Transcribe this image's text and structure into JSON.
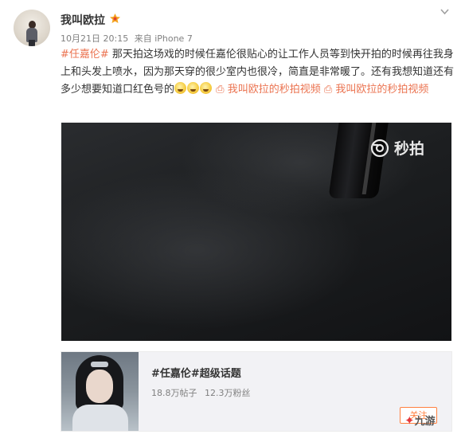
{
  "post": {
    "author": "我叫欧拉",
    "timestamp": "10月21日 20:15",
    "source": "来自 iPhone 7",
    "topic": "#任嘉伦#",
    "text_main": " 那天拍这场戏的时候任嘉伦很贴心的让工作人员等到快开拍的时候再往我身上和头发上喷水，因为那天穿的很少室内也很冷，简直是非常暖了。还有我想知道还有多少想要知道口红色号的",
    "video_link_1": "我叫欧拉的秒拍视频",
    "video_link_2": "我叫欧拉的秒拍视频",
    "more_icon": "chevron-down-icon"
  },
  "video": {
    "watermark": "秒拍",
    "watermark_icon": "camera-icon"
  },
  "topic_card": {
    "title": "#任嘉伦#超级话题",
    "posts": "18.8万帖子",
    "fans": "12.3万粉丝",
    "follow_label": "关注"
  },
  "site_logo": "九游",
  "colors": {
    "accent": "#eb7350",
    "follow": "#ff8140"
  }
}
